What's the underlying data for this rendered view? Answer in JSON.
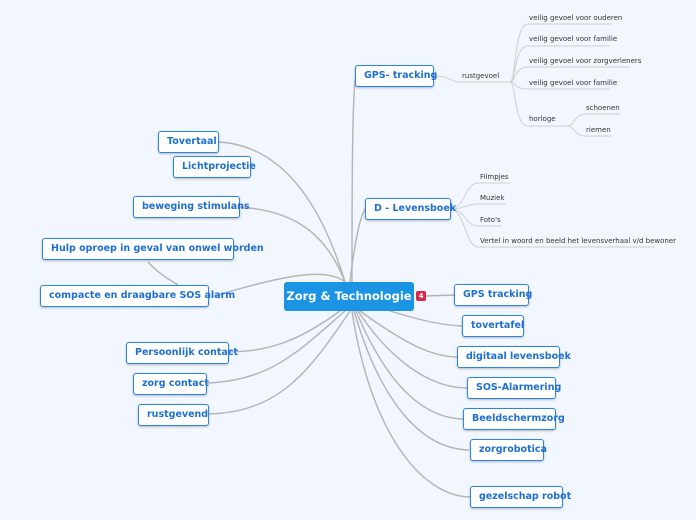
{
  "central": {
    "label": "Zorg & Technologie",
    "collapse_badge": "4"
  },
  "branches_right_top": [
    {
      "label": "GPS- tracking",
      "children": [
        {
          "label": "rustgevoel",
          "children": [
            {
              "label": "veilig gevoel voor ouderen"
            },
            {
              "label": "veilig gevoel voor familie"
            },
            {
              "label": "veilig gevoel voor zorgverleners"
            },
            {
              "label": "veilig gevoel voor familie"
            },
            {
              "label": "horloge",
              "children": [
                {
                  "label": "schoenen"
                },
                {
                  "label": "riemen"
                }
              ]
            }
          ]
        }
      ]
    },
    {
      "label": "D - Levensboek",
      "children": [
        {
          "label": "Filmpjes"
        },
        {
          "label": "Muziek"
        },
        {
          "label": "Foto's"
        },
        {
          "label": "Vertel in woord en beeld het levensverhaal v/d bewoner"
        }
      ]
    }
  ],
  "branches_right": [
    {
      "label": "GPS tracking"
    },
    {
      "label": "tovertafel"
    },
    {
      "label": "digitaal levensboek"
    },
    {
      "label": "SOS-Alarmering"
    },
    {
      "label": "Beeldschermzorg"
    },
    {
      "label": "zorgrobotica"
    },
    {
      "label": "gezelschap robot"
    }
  ],
  "branches_left": [
    {
      "label": "Tovertaal"
    },
    {
      "label": "Lichtprojectie"
    },
    {
      "label": "beweging stimulans"
    },
    {
      "label": "Hulp oproep in geval van onwel worden"
    },
    {
      "label": "compacte en draagbare SOS alarm"
    },
    {
      "label": "Persoonlijk contact"
    },
    {
      "label": "zorg contact"
    },
    {
      "label": "rustgevend"
    }
  ],
  "colors": {
    "background": "#f2f6fe",
    "central_fill": "#1c94e4",
    "node_border": "#2a86e0",
    "node_text": "#1d6fd1",
    "connector": "#b0b0b0",
    "badge": "#d9294a"
  }
}
